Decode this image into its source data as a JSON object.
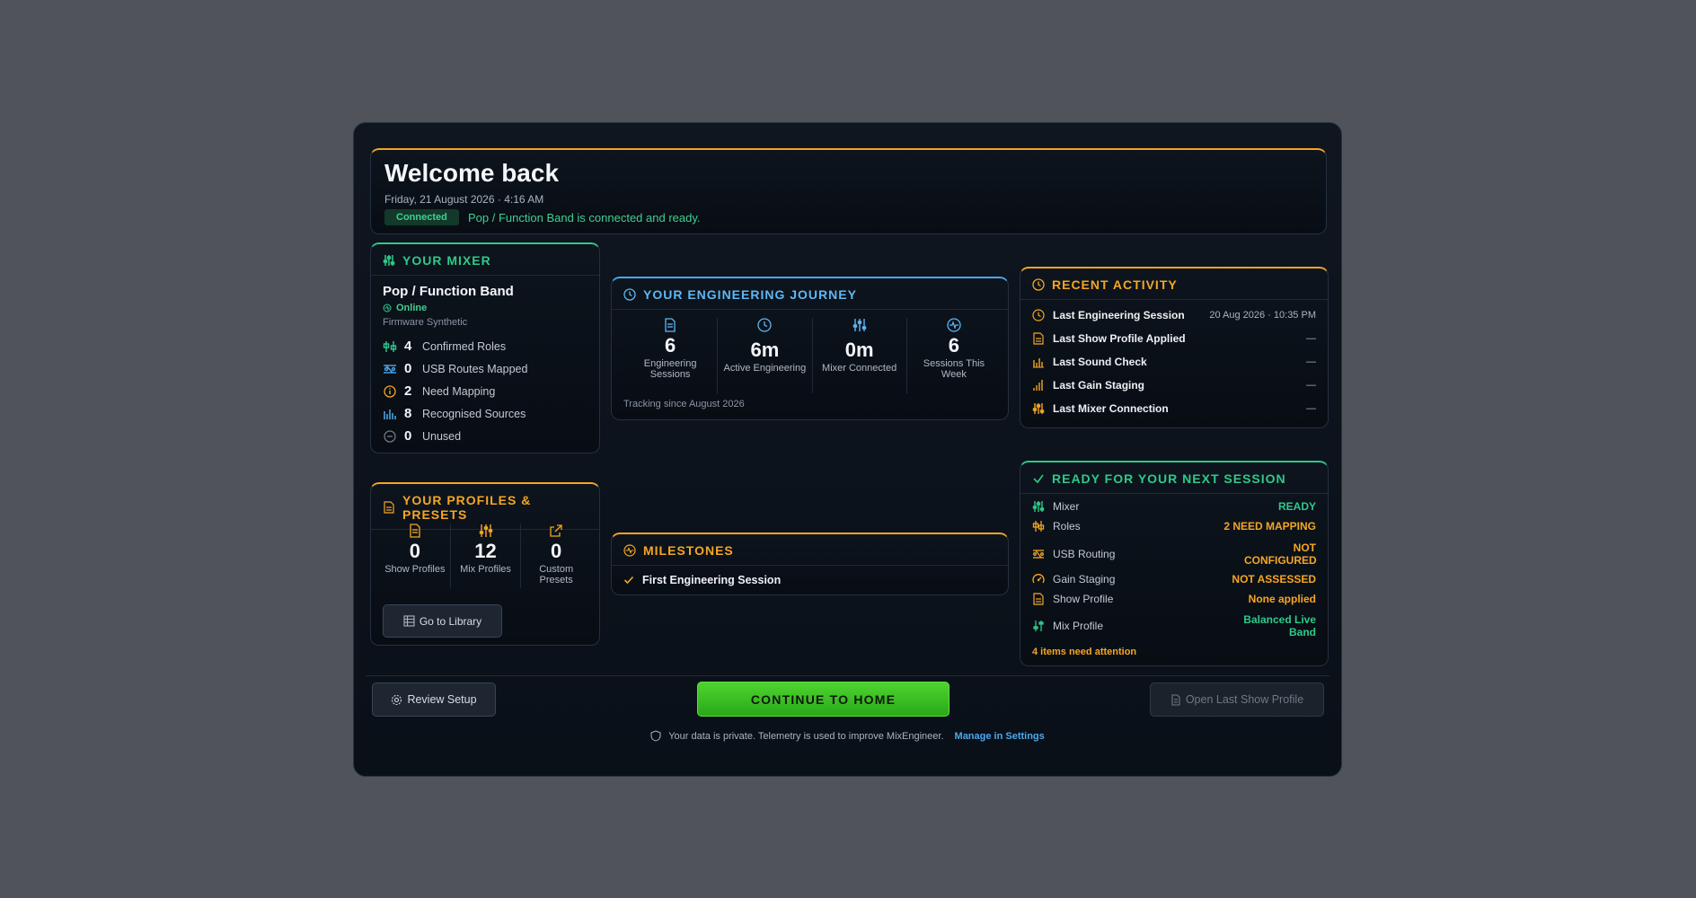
{
  "welcome": {
    "title": "Welcome back",
    "date": "Friday, 21 August 2026 · 4:16 AM",
    "badge": "Connected",
    "status": "Pop / Function Band is connected and ready."
  },
  "mixer": {
    "heading": "YOUR MIXER",
    "name": "Pop / Function Band",
    "online": "Online",
    "firmware": "Firmware Synthetic",
    "stats": [
      {
        "num": "4",
        "label": "Confirmed Roles",
        "icon": "roles-icon"
      },
      {
        "num": "0",
        "label": "USB Routes Mapped",
        "icon": "routing-icon"
      },
      {
        "num": "2",
        "label": "Need Mapping",
        "icon": "info-icon"
      },
      {
        "num": "8",
        "label": "Recognised Sources",
        "icon": "bars-icon"
      },
      {
        "num": "0",
        "label": "Unused",
        "icon": "minus-circle-icon"
      }
    ]
  },
  "journey": {
    "heading": "YOUR ENGINEERING JOURNEY",
    "cells": [
      {
        "value": "6",
        "label": "Engineering Sessions",
        "icon": "document-icon"
      },
      {
        "value": "6m",
        "label": "Active Engineering",
        "icon": "clock-icon"
      },
      {
        "value": "0m",
        "label": "Mixer Connected",
        "icon": "faders-icon"
      },
      {
        "value": "6",
        "label": "Sessions This Week",
        "icon": "pulse-icon"
      }
    ],
    "tracking": "Tracking since August 2026"
  },
  "activity": {
    "heading": "RECENT ACTIVITY",
    "rows": [
      {
        "label": "Last Engineering Session",
        "value": "20 Aug 2026 · 10:35 PM",
        "icon": "clock-icon"
      },
      {
        "label": "Last Show Profile Applied",
        "value": "—",
        "icon": "document-icon"
      },
      {
        "label": "Last Sound Check",
        "value": "—",
        "icon": "bars-icon"
      },
      {
        "label": "Last Gain Staging",
        "value": "—",
        "icon": "signal-icon"
      },
      {
        "label": "Last Mixer Connection",
        "value": "—",
        "icon": "faders-icon"
      }
    ]
  },
  "ready": {
    "heading": "READY FOR YOUR NEXT SESSION",
    "rows": [
      {
        "label": "Mixer",
        "value": "READY",
        "status": "green",
        "icon": "faders-icon"
      },
      {
        "label": "Roles",
        "value": "2 NEED MAPPING",
        "status": "orange",
        "icon": "roles-icon"
      },
      {
        "label": "USB Routing",
        "value": "NOT CONFIGURED",
        "status": "orange",
        "icon": "routing-icon"
      },
      {
        "label": "Gain Staging",
        "value": "NOT ASSESSED",
        "status": "orange",
        "icon": "gauge-icon"
      },
      {
        "label": "Show Profile",
        "value": "None applied",
        "status": "orange",
        "icon": "document-icon"
      },
      {
        "label": "Mix Profile",
        "value": "Balanced Live Band",
        "status": "green",
        "icon": "sliders-icon"
      }
    ],
    "attention": "4 items need attention"
  },
  "profiles": {
    "heading": "YOUR PROFILES & PRESETS",
    "cells": [
      {
        "value": "0",
        "label": "Show Profiles",
        "icon": "document-icon"
      },
      {
        "value": "12",
        "label": "Mix Profiles",
        "icon": "sliders-icon"
      },
      {
        "value": "0",
        "label": "Custom Presets",
        "icon": "external-icon"
      }
    ],
    "library_button": "Go to Library"
  },
  "milestones": {
    "heading": "MILESTONES",
    "items": [
      "First Engineering Session"
    ]
  },
  "footer": {
    "review": "Review Setup",
    "continue": "CONTINUE TO HOME",
    "open_last": "Open Last Show Profile",
    "privacy": "Your data is private. Telemetry is used to improve MixEngineer.",
    "manage": "Manage in Settings"
  },
  "colors": {
    "accent_orange": "#f5a623",
    "accent_green": "#2fc98a",
    "accent_blue": "#4aa8ee",
    "cta_green": "#3cc225",
    "background": "#50545a",
    "panel": "#0b1119"
  }
}
